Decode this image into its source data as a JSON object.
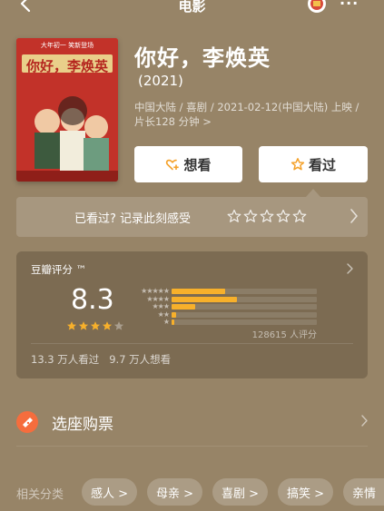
{
  "nav": {
    "title": "电影",
    "more": "···"
  },
  "movie": {
    "title": "你好，李焕英",
    "year": "(2021)",
    "meta": "中国大陆 / 喜剧 / 2021-02-12(中国大陆) 上映 / 片长128 分钟 >",
    "poster_title": "你好，李焕英",
    "poster_tagline": "大年初一 笑新登场"
  },
  "actions": {
    "want": "想看",
    "seen": "看过"
  },
  "record": {
    "text": "已看过? 记录此刻感受",
    "stars": 5
  },
  "rating": {
    "label": "豆瓣评分 ™",
    "score": "8.3",
    "stars": 4,
    "distribution": [
      {
        "stars": "★★★★★",
        "value": 0.37
      },
      {
        "stars": "★★★★",
        "value": 0.45
      },
      {
        "stars": "★★★",
        "value": 0.16
      },
      {
        "stars": "★★",
        "value": 0.03
      },
      {
        "stars": "★",
        "value": 0.02
      }
    ],
    "count": "128615 人评分",
    "watched": "13.3 万人看过   9.7 万人想看"
  },
  "ticket": {
    "label": "选座购票"
  },
  "tags": {
    "label": "相关分类",
    "items": [
      "感人 >",
      "母亲 >",
      "喜剧 >",
      "搞笑 >",
      "亲情"
    ]
  },
  "colors": {
    "background": "#978467",
    "card": "#7c6b52",
    "accent_orange": "#f7b02b",
    "ticket": "#f56d3d"
  }
}
